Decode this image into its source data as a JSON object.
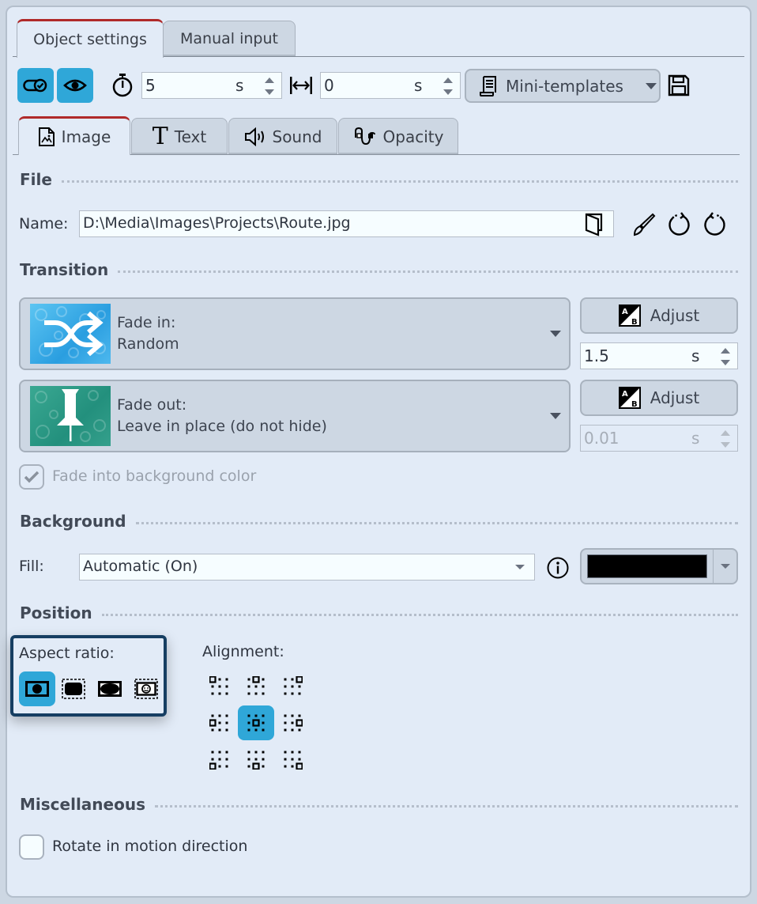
{
  "top_tabs": [
    {
      "label": "Object settings",
      "active": true
    },
    {
      "label": "Manual input",
      "active": false
    }
  ],
  "toolbar": {
    "toggle_icon": "toggle-check-icon",
    "visibility_icon": "eye-icon",
    "duration": {
      "icon": "stopwatch-icon",
      "value": "5",
      "unit": "s"
    },
    "offset": {
      "icon": "width-arrows-icon",
      "value": "0",
      "unit": "s"
    },
    "mini_templates_label": "Mini-templates",
    "mini_templates_icon": "scroll-icon",
    "save_icon": "floppy-disk-icon",
    "accent_color": "#2fa7d8"
  },
  "sub_tabs": [
    {
      "label": "Image",
      "icon": "image-file-icon",
      "active": true
    },
    {
      "label": "Text",
      "icon": "text-icon",
      "active": false
    },
    {
      "label": "Sound",
      "icon": "speaker-icon",
      "active": false
    },
    {
      "label": "Opacity",
      "icon": "opacity-curve-icon",
      "active": false
    }
  ],
  "file": {
    "heading": "File",
    "name_label": "Name:",
    "name_value": "D:\\Media\\Images\\Projects\\Route.jpg",
    "icons": [
      "open-folder-icon",
      "brush-icon",
      "rotate-left-icon",
      "rotate-right-icon"
    ]
  },
  "transition": {
    "heading": "Transition",
    "fade_in": {
      "title": "Fade in:",
      "value": "Random",
      "adjust_label": "Adjust",
      "duration": "1.5",
      "unit": "s"
    },
    "fade_out": {
      "title": "Fade out:",
      "value": "Leave in place (do not hide)",
      "adjust_label": "Adjust",
      "duration": "0.01",
      "unit": "s"
    },
    "fade_bg_label": "Fade into background color",
    "fade_bg_checked": true
  },
  "background": {
    "heading": "Background",
    "fill_label": "Fill:",
    "fill_value": "Automatic (On)",
    "color": "#000000"
  },
  "position": {
    "heading": "Position",
    "aspect_label": "Aspect ratio:",
    "aspect_options": [
      "fit-icon",
      "crop-fill-icon",
      "stretch-icon",
      "face-fit-icon"
    ],
    "aspect_selected": 0,
    "alignment_label": "Alignment:",
    "alignment_options": [
      "top-left",
      "top-center",
      "top-right",
      "middle-left",
      "center",
      "middle-right",
      "bottom-left",
      "bottom-center",
      "bottom-right"
    ],
    "alignment_selected": 4
  },
  "misc": {
    "heading": "Miscellaneous",
    "rotate_label": "Rotate in motion direction",
    "rotate_checked": false
  }
}
